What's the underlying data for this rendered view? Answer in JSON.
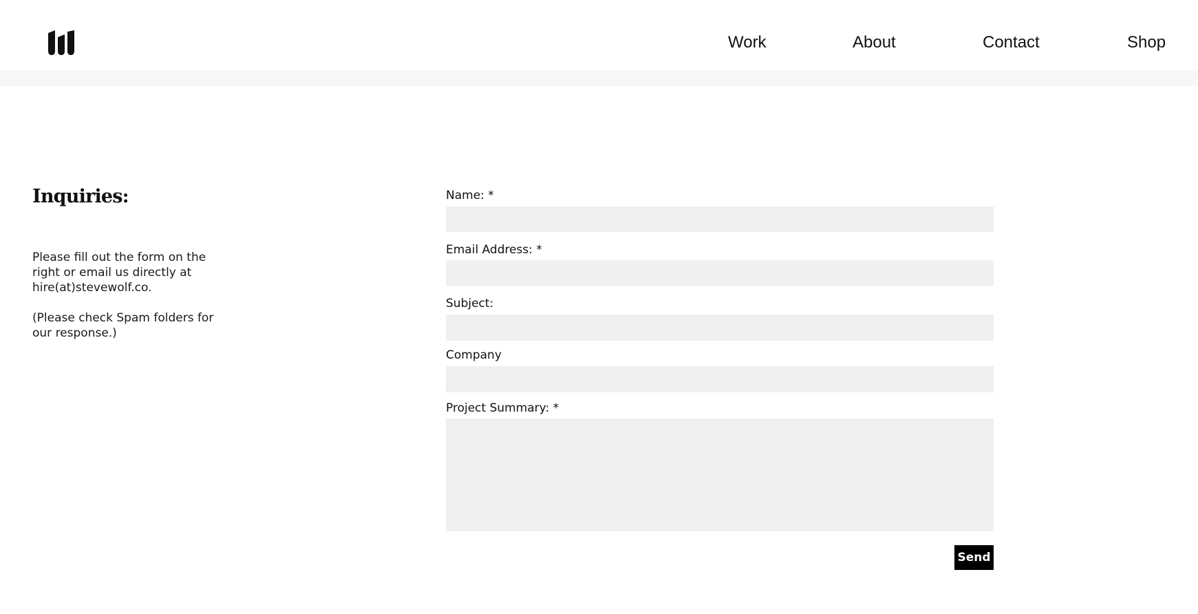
{
  "header": {
    "logo_icon": "steve-wolf-logo-icon",
    "nav": [
      {
        "label": "Work"
      },
      {
        "label": "About"
      },
      {
        "label": "Contact"
      },
      {
        "label": "Shop"
      }
    ]
  },
  "intro": {
    "heading": "Inquiries:",
    "paragraph1": "Please fill out the form on the right or email us directly at hire(at)stevewolf.co.",
    "paragraph2": "(Please check Spam folders for our response.)"
  },
  "form": {
    "fields": [
      {
        "label": "Name: *",
        "value": "",
        "placeholder": ""
      },
      {
        "label": "Email Address: *",
        "value": "",
        "placeholder": ""
      },
      {
        "label": "Subject:",
        "value": "",
        "placeholder": ""
      },
      {
        "label": "Company",
        "value": "",
        "placeholder": ""
      },
      {
        "label": "Project Summary: *",
        "value": "",
        "placeholder": ""
      }
    ],
    "submit_label": "Send"
  },
  "colors": {
    "background": "#ffffff",
    "band": "#f7f7f7",
    "field_background": "#f0f0f0",
    "button_background": "#000000",
    "button_text": "#ffffff",
    "text": "#111111"
  }
}
